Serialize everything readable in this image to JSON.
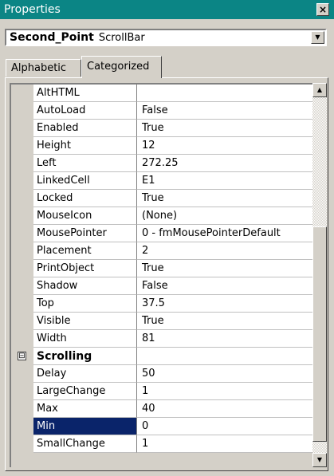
{
  "window": {
    "title": "Properties",
    "close_symbol": "×"
  },
  "object_selector": {
    "name": "Second_Point",
    "type": "ScrollBar"
  },
  "tabs": [
    {
      "label": "Alphabetic",
      "active": false
    },
    {
      "label": "Categorized",
      "active": true
    }
  ],
  "properties": [
    {
      "name": "AltHTML",
      "value": ""
    },
    {
      "name": "AutoLoad",
      "value": "False"
    },
    {
      "name": "Enabled",
      "value": "True"
    },
    {
      "name": "Height",
      "value": "12"
    },
    {
      "name": "Left",
      "value": "272.25"
    },
    {
      "name": "LinkedCell",
      "value": "E1"
    },
    {
      "name": "Locked",
      "value": "True"
    },
    {
      "name": "MouseIcon",
      "value": "(None)"
    },
    {
      "name": "MousePointer",
      "value": "0 - fmMousePointerDefault"
    },
    {
      "name": "Placement",
      "value": "2"
    },
    {
      "name": "PrintObject",
      "value": "True"
    },
    {
      "name": "Shadow",
      "value": "False"
    },
    {
      "name": "Top",
      "value": "37.5"
    },
    {
      "name": "Visible",
      "value": "True"
    },
    {
      "name": "Width",
      "value": "81"
    },
    {
      "category": "Scrolling",
      "expander": "⊟"
    },
    {
      "name": "Delay",
      "value": "50"
    },
    {
      "name": "LargeChange",
      "value": "1"
    },
    {
      "name": "Max",
      "value": "40"
    },
    {
      "name": "Min",
      "value": "0",
      "selected": true
    },
    {
      "name": "SmallChange",
      "value": "1"
    }
  ],
  "colors": {
    "titlebar": "#0b8585",
    "selection": "#0a246a",
    "face": "#d4d0c8"
  }
}
